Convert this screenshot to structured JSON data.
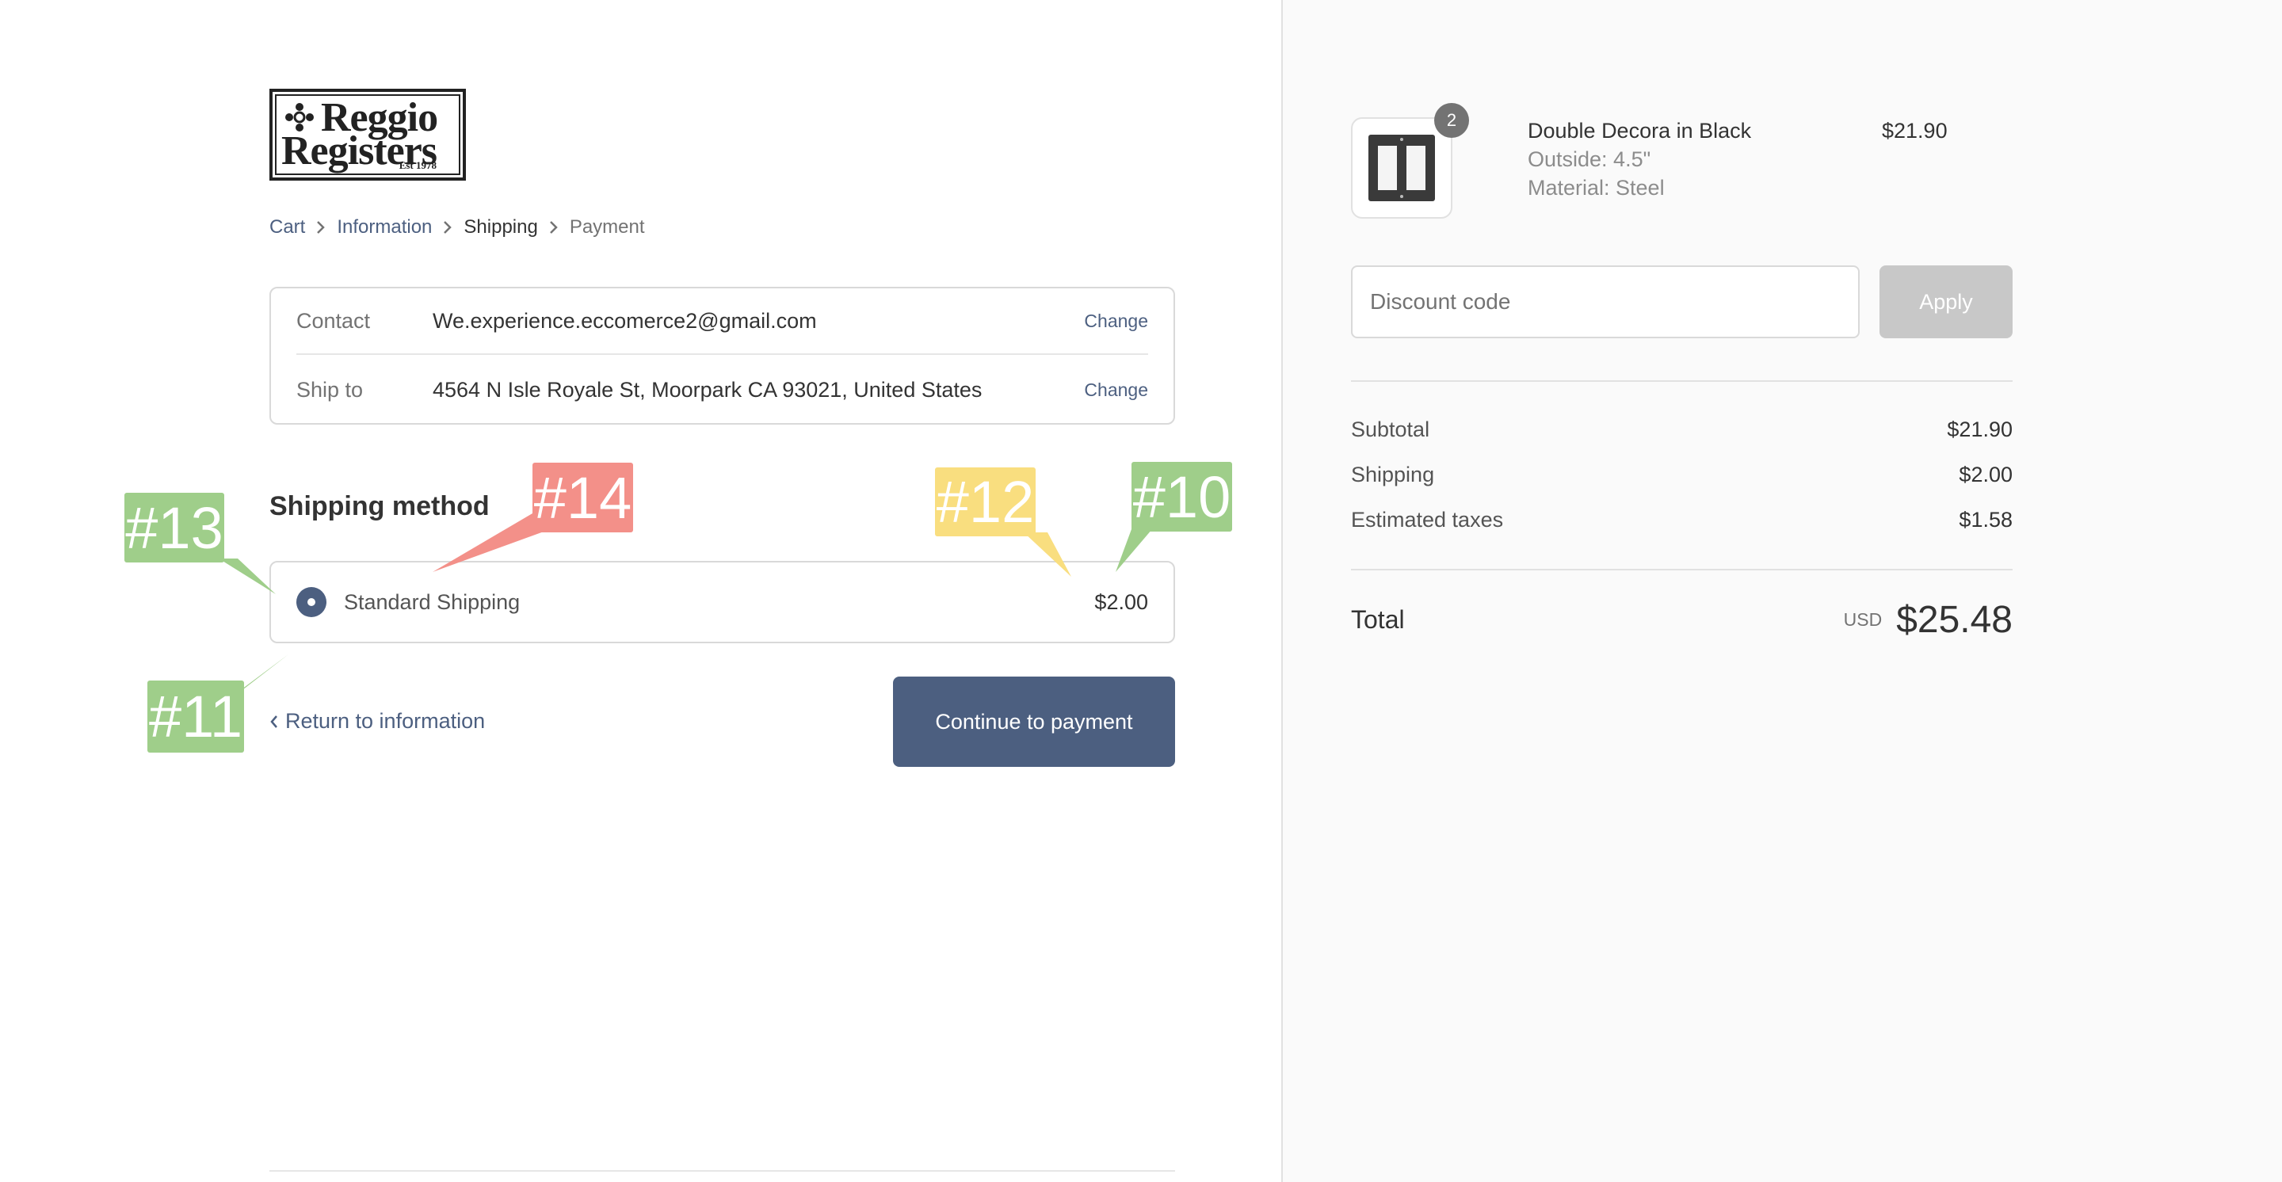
{
  "logo": {
    "line1": "Reggio",
    "line2": "Registers",
    "est": "Est 1978"
  },
  "breadcrumb": [
    {
      "label": "Cart",
      "state": "link"
    },
    {
      "label": "Information",
      "state": "link"
    },
    {
      "label": "Shipping",
      "state": "current"
    },
    {
      "label": "Payment",
      "state": "muted"
    }
  ],
  "review": {
    "contact": {
      "label": "Contact",
      "value": "We.experience.eccomerce2@gmail.com",
      "action": "Change"
    },
    "ship_to": {
      "label": "Ship to",
      "value": "4564 N Isle Royale St, Moorpark CA 93021, United States",
      "action": "Change"
    }
  },
  "shipping_method": {
    "title": "Shipping method",
    "option": {
      "name": "Standard Shipping",
      "price": "$2.00",
      "selected": true
    }
  },
  "actions": {
    "return_label": "Return to information",
    "continue_label": "Continue to payment"
  },
  "order": {
    "item": {
      "name": "Double Decora in Black",
      "option1": "Outside: 4.5\"",
      "option2": "Material: Steel",
      "price": "$21.90",
      "quantity": "2"
    },
    "discount": {
      "placeholder": "Discount code",
      "apply_label": "Apply"
    },
    "lines": [
      {
        "label": "Subtotal",
        "value": "$21.90"
      },
      {
        "label": "Shipping",
        "value": "$2.00"
      },
      {
        "label": "Estimated taxes",
        "value": "$1.58"
      }
    ],
    "total": {
      "label": "Total",
      "currency": "USD",
      "value": "$25.48"
    }
  },
  "annotations": [
    {
      "label": "#10",
      "color": "#9fce8a"
    },
    {
      "label": "#11",
      "color": "#9fce8a"
    },
    {
      "label": "#12",
      "color": "#f9de7f"
    },
    {
      "label": "#13",
      "color": "#9fce8a"
    },
    {
      "label": "#14",
      "color": "#f39089"
    }
  ],
  "colors": {
    "accent": "#4c5f80",
    "apply_disabled": "#c8c8c8"
  }
}
